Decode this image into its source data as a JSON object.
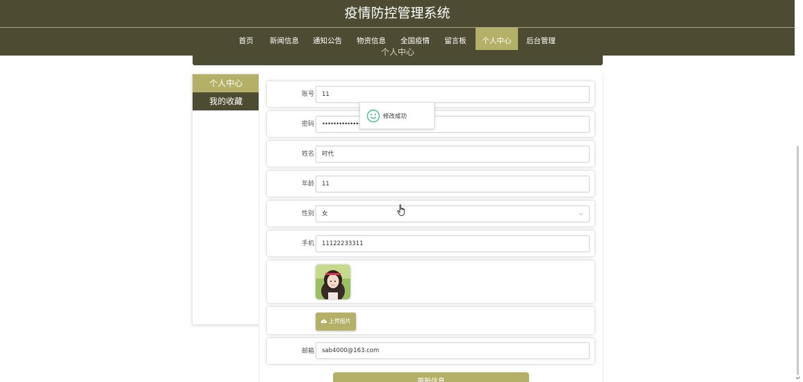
{
  "header": {
    "title": "疫情防控管理系统"
  },
  "nav": {
    "items": [
      {
        "label": "首页"
      },
      {
        "label": "新闻信息"
      },
      {
        "label": "通知公告"
      },
      {
        "label": "物资信息"
      },
      {
        "label": "全国疫情"
      },
      {
        "label": "留言板"
      },
      {
        "label": "个人中心",
        "active": true
      },
      {
        "label": "后台管理"
      }
    ]
  },
  "section": {
    "title": "个人中心"
  },
  "sidebar": {
    "items": [
      {
        "label": "个人中心",
        "active": true
      },
      {
        "label": "我的收藏"
      }
    ]
  },
  "form": {
    "account": {
      "label": "账号",
      "value": "11"
    },
    "password": {
      "label": "密码",
      "value": "••••••••••••••••"
    },
    "name": {
      "label": "姓名",
      "value": "时代"
    },
    "age": {
      "label": "年龄",
      "value": "11"
    },
    "gender": {
      "label": "性别",
      "value": "女"
    },
    "phone": {
      "label": "手机",
      "value": "11122233311"
    },
    "upload_label": "上传图片",
    "email": {
      "label": "邮箱",
      "value": "sab4000@163.com"
    },
    "submit_label": "更新信息"
  },
  "toast": {
    "message": "修改成功"
  },
  "colors": {
    "header_bg": "#4d4b32",
    "accent": "#b4b067",
    "toast_icon": "#3fbf7f"
  },
  "icons": {
    "toast": "smile-icon",
    "upload": "cloud-upload-icon",
    "select": "chevron-down-icon"
  }
}
